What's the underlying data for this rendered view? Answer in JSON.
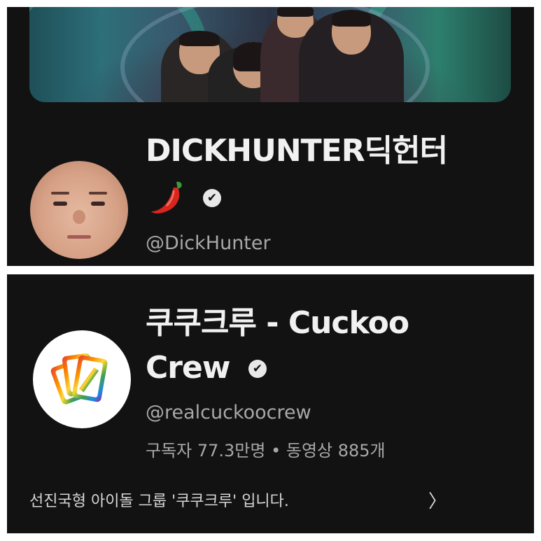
{
  "channel_a": {
    "title": "DICKHUNTER딕헌터",
    "emoji": "🌶",
    "verified_icon": "✔",
    "handle": "@DickHunter"
  },
  "channel_b": {
    "title_line1": "쿠쿠크루 - Cuckoo",
    "title_line2": "Crew",
    "verified_icon": "✔",
    "handle": "@realcuckoocrew",
    "stats": "구독자 77.3만명 • 동영상 885개",
    "description": "선진국형 아이돌 그룹 '쿠쿠크루' 입니다.",
    "more_icon": "〉"
  },
  "colors": {
    "background": "#121212",
    "title": "#f1f1f1",
    "secondary": "#a8a8a8",
    "separator": "#ffffff"
  }
}
